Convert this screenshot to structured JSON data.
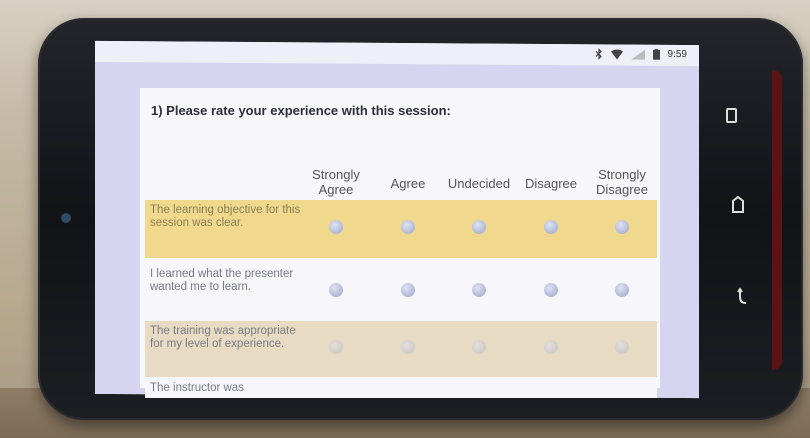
{
  "status_bar": {
    "time": "9:59",
    "icons": [
      "bluetooth-icon",
      "wifi-icon",
      "signal-icon",
      "battery-icon"
    ]
  },
  "survey": {
    "question": "1) Please rate your experience with this session:",
    "columns": [
      "Strongly Agree",
      "Agree",
      "Undecided",
      "Disagree",
      "Strongly Disagree"
    ],
    "rows": [
      {
        "label": "The learning objective for this session was clear.",
        "highlight": "#f0d98c"
      },
      {
        "label": "I learned what the presenter wanted me to learn.",
        "highlight": "#f6f6fb"
      },
      {
        "label": "The training was appropriate for my level of experience.",
        "highlight": "#e7dcc3"
      },
      {
        "label": "The instructor was",
        "highlight": "#f6f6fb"
      }
    ]
  },
  "nav_buttons": [
    "recent-apps-icon",
    "home-icon",
    "back-icon"
  ]
}
